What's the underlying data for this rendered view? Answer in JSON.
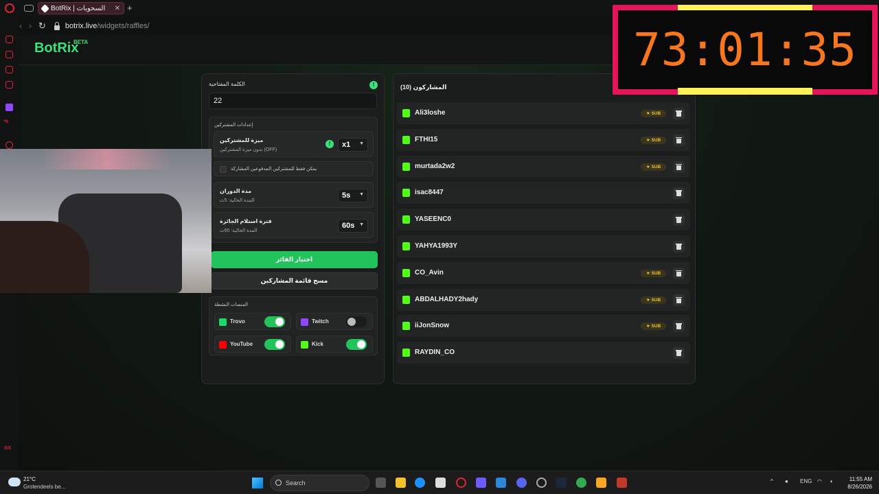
{
  "browser": {
    "tab_title": "BotRix | السحوبات",
    "url_host": "botrix.live",
    "url_path": "/widgets/raffles/"
  },
  "sidebar": {
    "bottom_label": "GX"
  },
  "brand": {
    "name": "BotRix",
    "badge": "BETA"
  },
  "settings": {
    "keyword_label": "الكلمة المفتاحية",
    "keyword_value": "22",
    "subscribers_heading": "إعدادات المشتركين",
    "sub_benefit_title": "ميزة للمشتركين",
    "sub_benefit_desc": "بدون ميزة المشتركين (OFF)",
    "sub_benefit_value": "x1",
    "paid_only_label": "يمكن فقط للمشتركين المدفوعين المشاركة",
    "rotation_title": "مدة الدوران",
    "rotation_desc": "المدة الحالية: 5ث",
    "rotation_value": "5s",
    "claim_title": "فترة استلام الجائزة",
    "claim_desc": "المدة الحالية: 60ث",
    "claim_value": "60s",
    "pick_winner_label": "اختيار الفائز",
    "clear_list_label": "مسح قائمة المشاركين",
    "platforms_heading": "المنصات النشطة",
    "platforms": [
      {
        "name": "Trovo",
        "enabled": true
      },
      {
        "name": "Twitch",
        "enabled": false
      },
      {
        "name": "YouTube",
        "enabled": true
      },
      {
        "name": "Kick",
        "enabled": true
      }
    ]
  },
  "participants": {
    "title": "المشاركون (10)",
    "sub_label": "SUB",
    "list": [
      {
        "name": "Ali3loshe",
        "sub": true
      },
      {
        "name": "FTHI15",
        "sub": true
      },
      {
        "name": "murtada2w2",
        "sub": true
      },
      {
        "name": "isac8447",
        "sub": false
      },
      {
        "name": "YASEENC0",
        "sub": false
      },
      {
        "name": "YAHYA1993Y",
        "sub": false
      },
      {
        "name": "CO_Avin",
        "sub": true
      },
      {
        "name": "ABDALHADY2hady",
        "sub": true
      },
      {
        "name": "iiJonSnow",
        "sub": true
      },
      {
        "name": "RAYDIN_CO",
        "sub": false
      }
    ]
  },
  "timer": {
    "text": "73:01:35",
    "color": "#f7771f",
    "frame_color": "#e4155a"
  },
  "taskbar": {
    "temperature": "21°C",
    "weather": "Grotendeels be...",
    "search_placeholder": "Search",
    "language": "ENG",
    "time": "11:55 AM",
    "date": "8/26/2026"
  },
  "colors": {
    "accent": "#22c35a",
    "kick": "#53fc18",
    "sub_badge": "#f0c419"
  }
}
